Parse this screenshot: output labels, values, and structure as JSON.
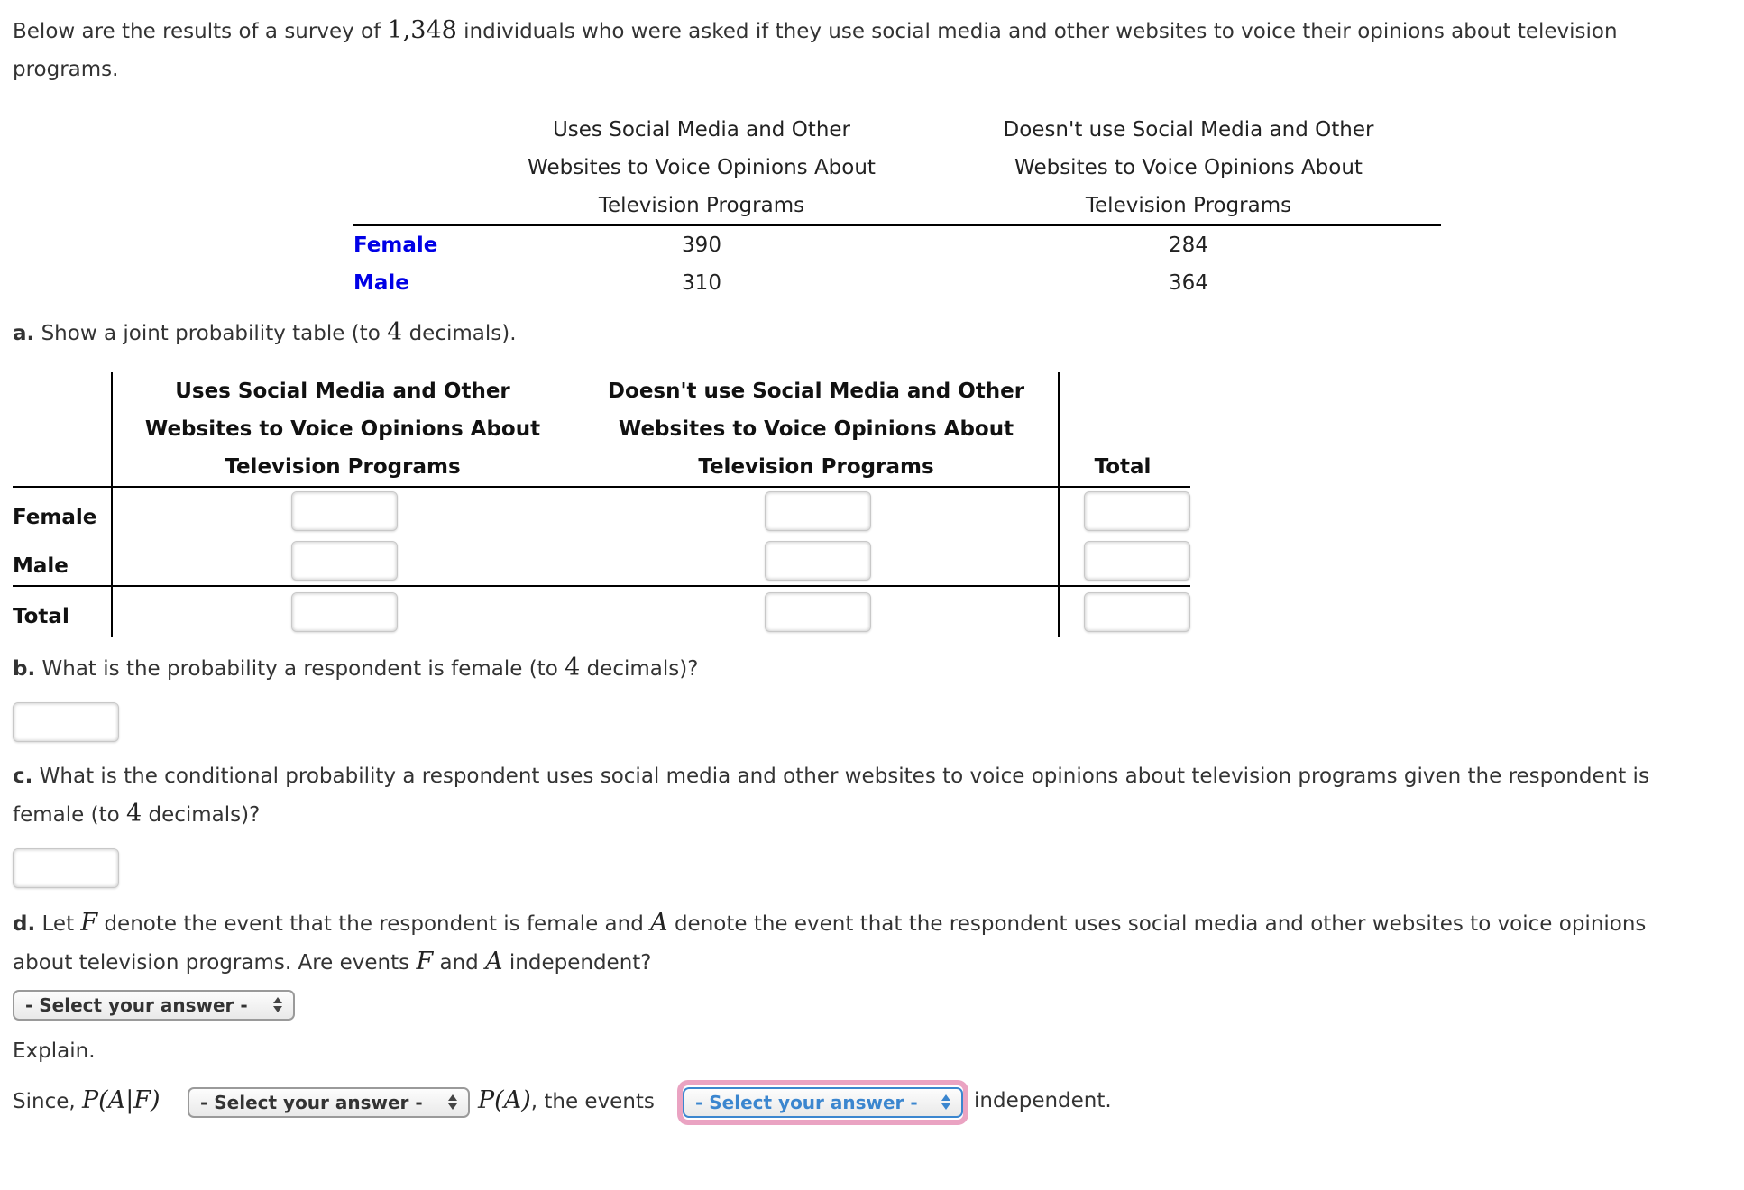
{
  "intro": {
    "before": "Below are the results of a survey of ",
    "total": "1,348",
    "after": " individuals who were asked if they use social media and other websites to voice their opinions about television",
    "line2": "programs."
  },
  "survey_table": {
    "columns": [
      [
        "Uses Social Media and Other",
        "Websites to Voice Opinions About",
        "Television Programs"
      ],
      [
        "Doesn't use Social Media and Other",
        "Websites to Voice Opinions About",
        "Television Programs"
      ]
    ],
    "rows": [
      {
        "label": "Female",
        "values": [
          "390",
          "284"
        ]
      },
      {
        "label": "Male",
        "values": [
          "310",
          "364"
        ]
      }
    ],
    "row_label_color": "#0000e6"
  },
  "part_a": {
    "letter": "a.",
    "text_before": " Show a joint probability table (to ",
    "decimals": "4",
    "text_after": " decimals).",
    "columns": [
      [
        "Uses Social Media and Other",
        "Websites to Voice Opinions About",
        "Television Programs"
      ],
      [
        "Doesn't use Social Media and Other",
        "Websites to Voice Opinions About",
        "Television Programs"
      ],
      [
        "Total"
      ]
    ],
    "rows": [
      "Female",
      "Male",
      "Total"
    ],
    "cells": [
      [
        "",
        "",
        ""
      ],
      [
        "",
        "",
        ""
      ],
      [
        "",
        "",
        ""
      ]
    ]
  },
  "part_b": {
    "letter": "b.",
    "text_before": " What is the probability a respondent is female (to ",
    "decimals": "4",
    "text_after": " decimals)?",
    "answer": ""
  },
  "part_c": {
    "letter": "c.",
    "line1": " What is the conditional probability a respondent uses social media and other websites to voice opinions about television programs given the respondent is",
    "line2_before": "female (to ",
    "decimals": "4",
    "line2_after": " decimals)?",
    "answer": ""
  },
  "part_d": {
    "letter": "d.",
    "t1": " Let ",
    "F": "F",
    "t2": " denote the event that the respondent is female and ",
    "A": "A",
    "t3": " denote the event that the respondent uses social media and other websites to voice opinions",
    "l2a": "about television programs. Are events ",
    "l2b": " and ",
    "l2c": " independent?",
    "select_label": "- Select your answer -",
    "explain": "Explain.",
    "since": "Since, ",
    "paf": "P(A|F)",
    "pa": "P(A)",
    "the_events": ", the events",
    "independent": "independent.",
    "select2_label": "- Select your answer -",
    "select3_label": "- Select your answer -",
    "focus_color": "#eaa3c2",
    "focus_select_color": "#3b86cf"
  }
}
